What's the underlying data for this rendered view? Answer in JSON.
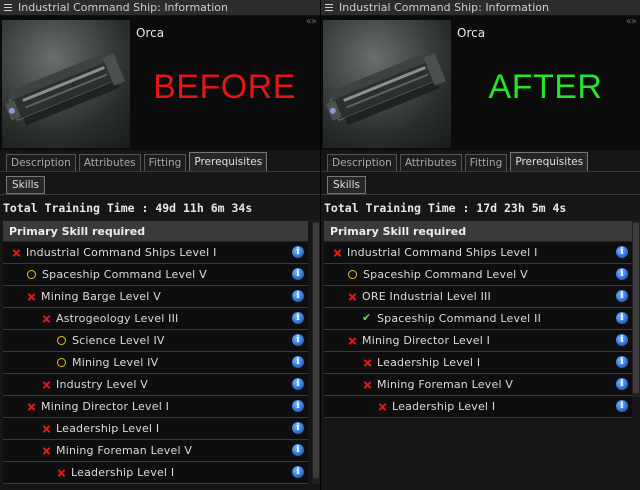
{
  "left": {
    "title": "Industrial Command Ship: Information",
    "ship_name": "Orca",
    "overlay": "BEFORE",
    "overlay_color": "#e11616",
    "tabs": [
      "Description",
      "Attributes",
      "Fitting",
      "Prerequisites"
    ],
    "active_tab": "Prerequisites",
    "subtab": "Skills",
    "total_training": "Total Training Time : 49d 11h 6m 34s",
    "table_header": "Primary Skill required",
    "skills": [
      {
        "label": "Industrial Command Ships Level I",
        "status": "missing",
        "indent": 0
      },
      {
        "label": "Spaceship Command Level V",
        "status": "partial",
        "indent": 1
      },
      {
        "label": "Mining Barge Level V",
        "status": "missing",
        "indent": 1
      },
      {
        "label": "Astrogeology Level III",
        "status": "missing",
        "indent": 2
      },
      {
        "label": "Science Level IV",
        "status": "partial",
        "indent": 3
      },
      {
        "label": "Mining Level IV",
        "status": "partial",
        "indent": 3
      },
      {
        "label": "Industry Level V",
        "status": "missing",
        "indent": 2
      },
      {
        "label": "Mining Director Level I",
        "status": "missing",
        "indent": 1
      },
      {
        "label": "Leadership Level I",
        "status": "missing",
        "indent": 2
      },
      {
        "label": "Mining Foreman Level V",
        "status": "missing",
        "indent": 2
      },
      {
        "label": "Leadership Level I",
        "status": "missing",
        "indent": 3
      }
    ]
  },
  "right": {
    "title": "Industrial Command Ship: Information",
    "ship_name": "Orca",
    "overlay": "AFTER",
    "overlay_color": "#27e32c",
    "tabs": [
      "Description",
      "Attributes",
      "Fitting",
      "Prerequisites"
    ],
    "active_tab": "Prerequisites",
    "subtab": "Skills",
    "total_training": "Total Training Time : 17d 23h 5m 4s",
    "table_header": "Primary Skill required",
    "skills": [
      {
        "label": "Industrial Command Ships Level I",
        "status": "missing",
        "indent": 0
      },
      {
        "label": "Spaceship Command Level V",
        "status": "partial",
        "indent": 1
      },
      {
        "label": "ORE Industrial Level III",
        "status": "missing",
        "indent": 1
      },
      {
        "label": "Spaceship Command Level II",
        "status": "done",
        "indent": 2
      },
      {
        "label": "Mining Director Level I",
        "status": "missing",
        "indent": 1
      },
      {
        "label": "Leadership Level I",
        "status": "missing",
        "indent": 2
      },
      {
        "label": "Mining Foreman Level V",
        "status": "missing",
        "indent": 2
      },
      {
        "label": "Leadership Level I",
        "status": "missing",
        "indent": 3
      }
    ]
  },
  "icons": {
    "window_menu": "menu-icon",
    "collapse": "collapse-arrows-icon",
    "missing": "red-x-icon",
    "partial": "yellow-circle-icon",
    "done": "green-check-icon",
    "info": "info-icon"
  }
}
